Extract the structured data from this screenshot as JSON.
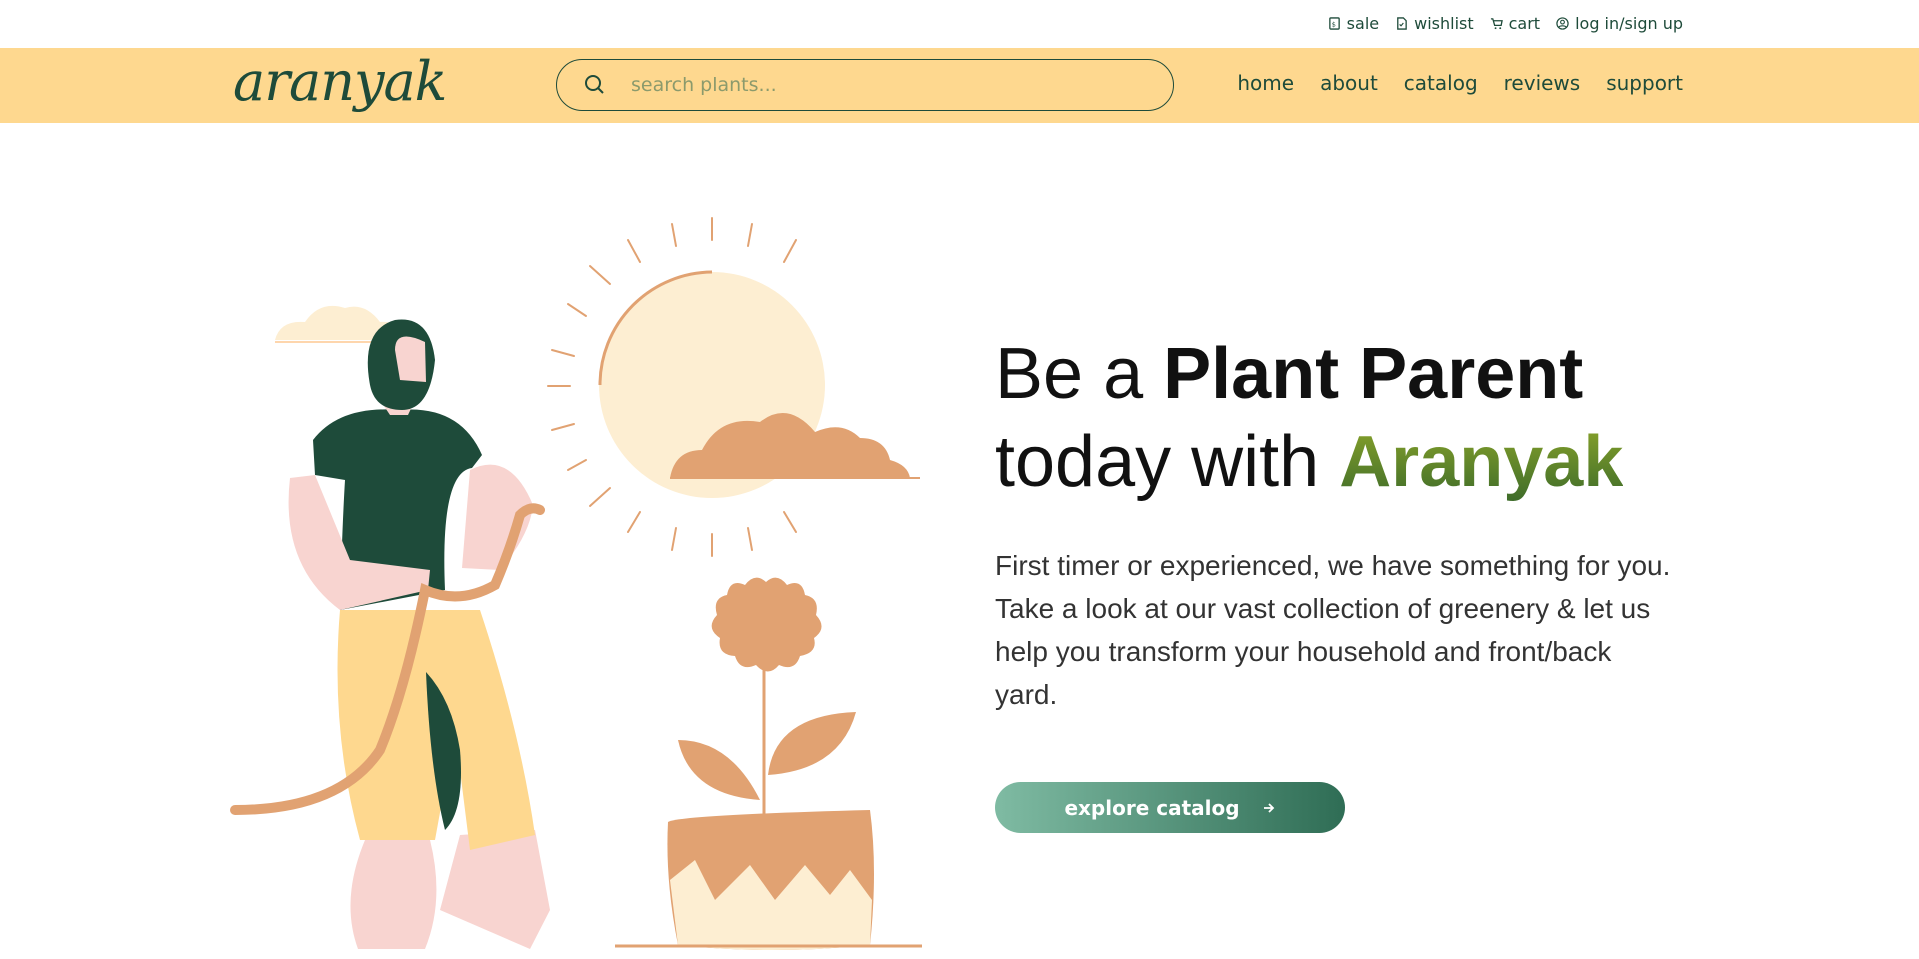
{
  "utility_links": [
    {
      "label": "sale",
      "icon": "sale-tag-icon"
    },
    {
      "label": "wishlist",
      "icon": "wishlist-icon"
    },
    {
      "label": "cart",
      "icon": "cart-icon"
    },
    {
      "label": "log in/sign up",
      "icon": "user-icon"
    }
  ],
  "header": {
    "logo": "aranyak",
    "search_placeholder": "search plants...",
    "nav": [
      "home",
      "about",
      "catalog",
      "reviews",
      "support"
    ]
  },
  "hero": {
    "headline_line1_a": "Be a ",
    "headline_line1_b": "Plant Parent",
    "headline_line2_a": "today with ",
    "headline_line2_b": "Aranyak",
    "subtext": "First timer or experienced, we have something for you. Take a look at our vast collection of greenery & let us help you transform your household and front/back yard.",
    "cta_label": "explore catalog"
  },
  "colors": {
    "navbar_bg": "#fed88f",
    "brand_green": "#1e4b3a",
    "accent_orange": "#e1a272",
    "sun_fill": "#fdeed2"
  }
}
